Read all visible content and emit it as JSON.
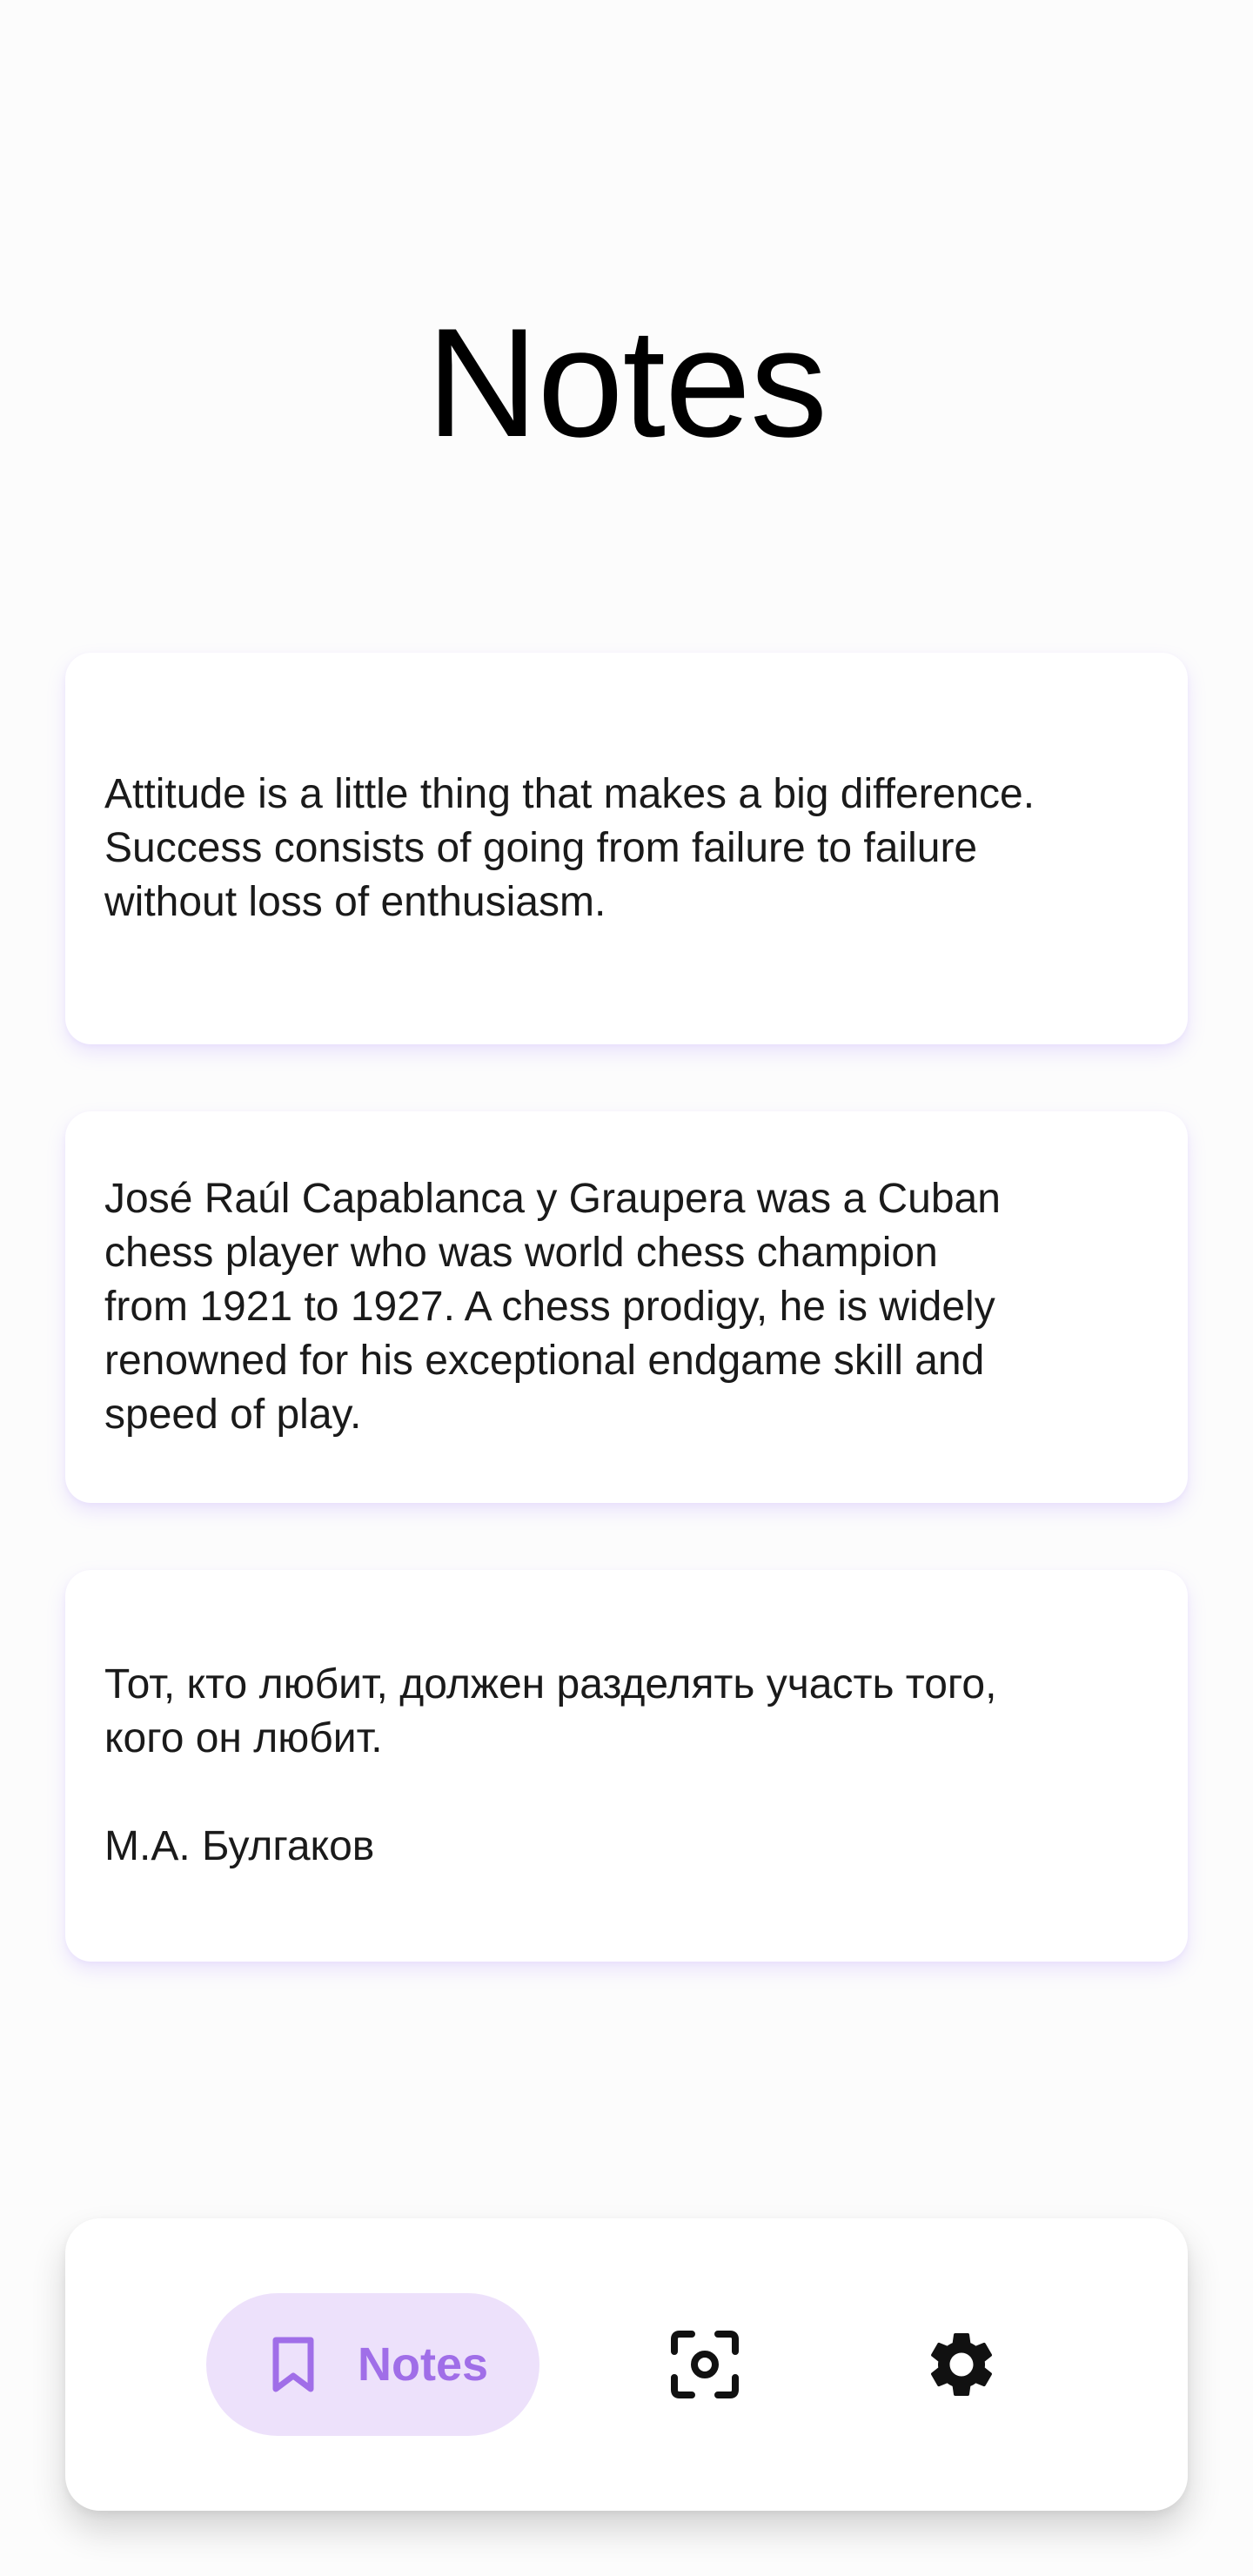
{
  "header": {
    "title": "Notes"
  },
  "notes": [
    {
      "text": "Attitude is a little thing that makes a big difference.\nSuccess consists of going from failure to failure\nwithout loss of enthusiasm."
    },
    {
      "text": "José Raúl Capablanca y Graupera was a Cuban\nchess player who was world chess champion\nfrom 1921 to 1927. A chess prodigy, he is widely\nrenowned for his exceptional endgame skill and\nspeed of play."
    },
    {
      "text": "Тот, кто любит, должен разделять участь того,\nкого он любит.\n\nМ.А. Булгаков"
    }
  ],
  "bottom_nav": {
    "items": [
      {
        "label": "Notes",
        "icon": "bookmark-icon",
        "selected": true
      },
      {
        "icon": "scan-icon",
        "selected": false
      },
      {
        "icon": "gear-icon",
        "selected": false
      }
    ]
  },
  "colors": {
    "accent": "#a06ee8",
    "selected_pill": "#ede1fb",
    "card_shadow": "#9e78ff",
    "background": "#fcfcfc"
  }
}
